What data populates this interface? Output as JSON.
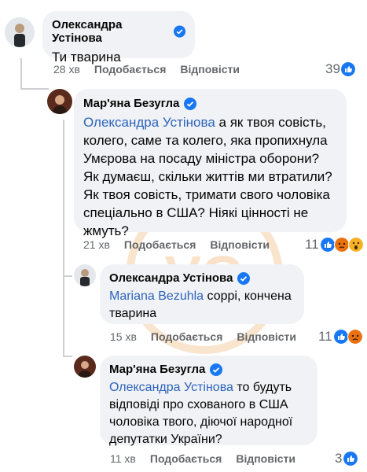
{
  "comments": [
    {
      "author": "Олександра Устінова",
      "mention": "",
      "text": "Ти тварина",
      "time": "28 хв",
      "like_label": "Подобається",
      "reply_label": "Відповісти",
      "reaction_count": "39",
      "reactions": [
        "like-icon"
      ]
    },
    {
      "author": "Мар'яна Безугла",
      "mention": "Олександра Устінова",
      "text": " а як твоя совість, колего, саме та колего, яка пропихнула Умєрова на посаду міністра оборони? Як думаєш, скільки життів ми втратили? Як твоя совість, тримати свого чоловіка спеціально в США? Ніякі цінності не жмуть?",
      "time": "21 хв",
      "like_label": "Подобається",
      "reply_label": "Відповісти",
      "reaction_count": "11",
      "reactions": [
        "like-icon",
        "angry-icon",
        "wow-icon"
      ]
    },
    {
      "author": "Олександра Устінова",
      "mention": "Mariana Bezuhla",
      "text": " соррі, кончена тварина",
      "time": "15 хв",
      "like_label": "Подобається",
      "reply_label": "Відповісти",
      "reaction_count": "11",
      "reactions": [
        "like-icon",
        "angry-icon"
      ]
    },
    {
      "author": "Мар'яна Безугла",
      "mention": "Олександра Устінова",
      "text": " то будуть відповіді про схованого в США чоловіка твого, діючої народної депутатки України?",
      "time": "11 хв",
      "like_label": "Подобається",
      "reply_label": "Відповісти",
      "reaction_count": "3",
      "reactions": [
        "like-icon"
      ]
    }
  ],
  "colors": {
    "bubble": "#f0f2f5",
    "mention": "#2d64bc",
    "verified": "#1877f2",
    "meta": "#65676b",
    "like": "#1877f2",
    "angry": "#e9710f",
    "wow": "#f7b125"
  },
  "watermark": "VG"
}
